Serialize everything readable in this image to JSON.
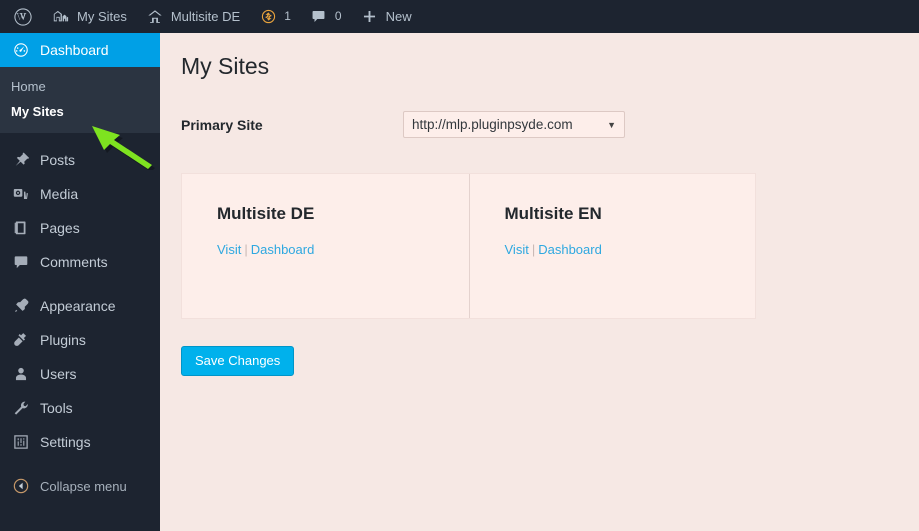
{
  "adminbar": {
    "items": [
      {
        "name": "wp-logo",
        "icon": "wordpress-icon",
        "label": "",
        "count": null
      },
      {
        "name": "my-sites",
        "icon": "sites-icon",
        "label": "My Sites",
        "count": null
      },
      {
        "name": "site-name",
        "icon": "home-icon",
        "label": "Multisite DE",
        "count": null
      },
      {
        "name": "updates",
        "icon": "update-icon",
        "label": "",
        "count": "1"
      },
      {
        "name": "comments",
        "icon": "comment-icon",
        "label": "",
        "count": "0"
      },
      {
        "name": "new-content",
        "icon": "plus-icon",
        "label": "New",
        "count": null
      }
    ]
  },
  "sidebar": {
    "items": [
      {
        "label": "Dashboard",
        "icon": "dashboard-icon",
        "current": true
      },
      {
        "label": "Posts",
        "icon": "posts-icon",
        "current": false
      },
      {
        "label": "Media",
        "icon": "media-icon",
        "current": false
      },
      {
        "label": "Pages",
        "icon": "pages-icon",
        "current": false
      },
      {
        "label": "Comments",
        "icon": "comments-icon",
        "current": false
      },
      {
        "label": "Appearance",
        "icon": "appearance-icon",
        "current": false
      },
      {
        "label": "Plugins",
        "icon": "plugins-icon",
        "current": false
      },
      {
        "label": "Users",
        "icon": "users-icon",
        "current": false
      },
      {
        "label": "Tools",
        "icon": "tools-icon",
        "current": false
      },
      {
        "label": "Settings",
        "icon": "settings-icon",
        "current": false
      }
    ],
    "submenu": [
      {
        "label": "Home",
        "current": false
      },
      {
        "label": "My Sites",
        "current": true
      }
    ],
    "collapse": {
      "label": "Collapse menu",
      "icon": "collapse-arrow-icon"
    }
  },
  "main": {
    "title": "My Sites",
    "primary_site": {
      "label": "Primary Site",
      "selected": "http://mlp.pluginpsyde.com",
      "arrow": "▼"
    },
    "sites": [
      {
        "name": "Multisite DE",
        "visit_label": "Visit",
        "separator": "|",
        "dashboard_label": "Dashboard"
      },
      {
        "name": "Multisite EN",
        "visit_label": "Visit",
        "separator": "|",
        "dashboard_label": "Dashboard"
      }
    ],
    "save_label": "Save Changes"
  },
  "annotation": {
    "type": "arrow",
    "color": "#7ee320",
    "points_to": "My Sites"
  },
  "colors": {
    "admin_dark": "#1d2430",
    "submenu_bg": "#2b3441",
    "accent_blue": "#00a0e6",
    "page_bg": "#f6e8e4",
    "card_bg": "#fdeeea",
    "link_blue": "#2ea8e0",
    "button_blue": "#00b1ec",
    "arrow_green": "#7ee320"
  }
}
